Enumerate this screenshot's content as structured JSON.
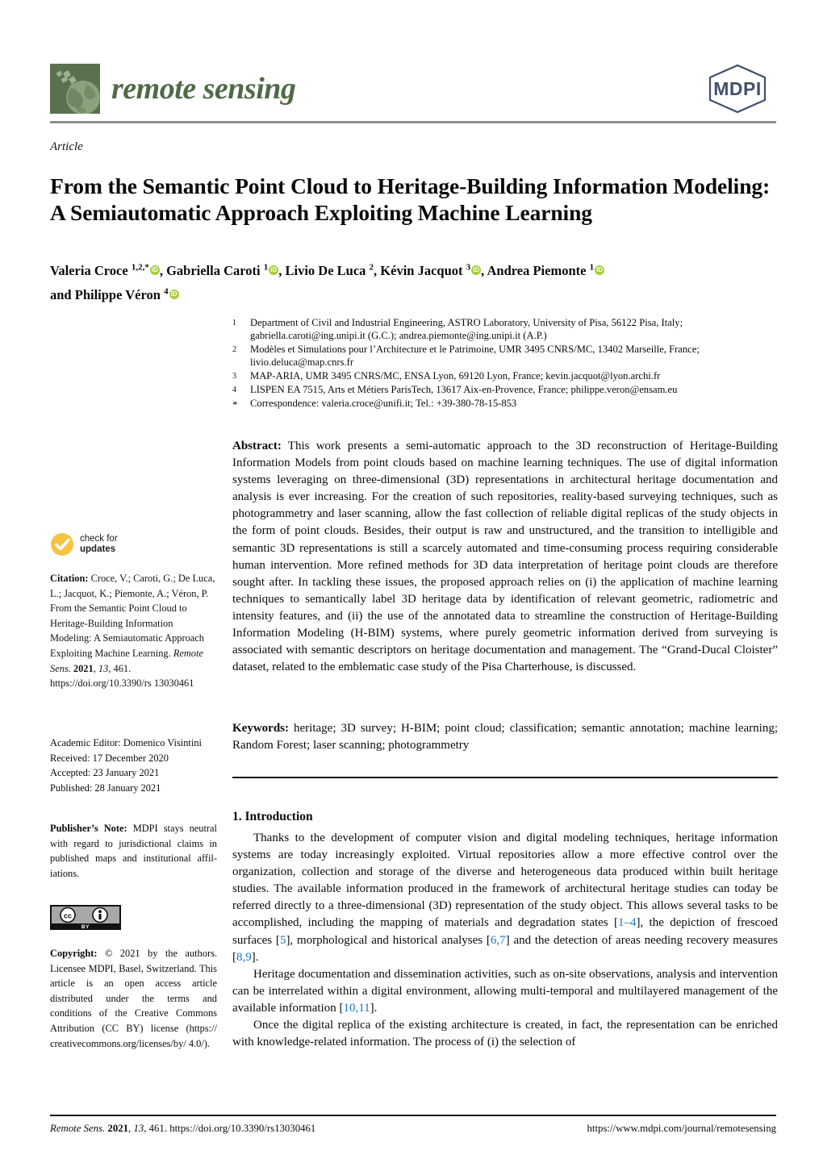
{
  "journal": {
    "name": "remote sensing",
    "logo_icon": "satellite-globe-icon",
    "logo_bg_color": "#5a7150",
    "title_color": "#4e6b46",
    "publisher_logo_text": "MDPI",
    "publisher_logo_color": "#41506b"
  },
  "article": {
    "kicker": "Article",
    "title": "From the Semantic Point Cloud to Heritage-Building Information Modeling: A Semiautomatic Approach Exploiting Machine Learning"
  },
  "authors": {
    "line1_parts": [
      {
        "name": "Valeria Croce ",
        "sup": "1,2,*",
        "orcid": true,
        "sep": ", "
      },
      {
        "name": "Gabriella Caroti ",
        "sup": "1",
        "orcid": true,
        "sep": ", "
      },
      {
        "name": "Livio De Luca ",
        "sup": "2",
        "orcid": false,
        "sep": ", "
      },
      {
        "name": "Kévin Jacquot ",
        "sup": "3",
        "orcid": true,
        "sep": ", "
      },
      {
        "name": "Andrea Piemonte ",
        "sup": "1",
        "orcid": true,
        "sep": ""
      }
    ],
    "line2_lead": "and ",
    "line2_parts": [
      {
        "name": "Philippe Véron ",
        "sup": "4",
        "orcid": true,
        "sep": ""
      }
    ],
    "orcid_label": "iD",
    "orcid_color": "#a6ce39"
  },
  "affiliations": [
    {
      "mark": "1",
      "text": "Department of Civil and Industrial Engineering, ASTRO Laboratory, University of Pisa, 56122 Pisa, Italy; gabriella.caroti@ing.unipi.it (G.C.); andrea.piemonte@ing.unipi.it (A.P.)"
    },
    {
      "mark": "2",
      "text": "Modèles et Simulations pour l’Architecture et le Patrimoine, UMR 3495 CNRS/MC, 13402 Marseille, France; livio.deluca@map.cnrs.fr"
    },
    {
      "mark": "3",
      "text": "MAP-ARIA, UMR 3495 CNRS/MC, ENSA Lyon, 69120 Lyon, France; kevin.jacquot@lyon.archi.fr"
    },
    {
      "mark": "4",
      "text": "LISPEN EA 7515, Arts et Métiers ParisTech, 13617 Aix-en-Provence, France; philippe.veron@ensam.eu"
    },
    {
      "mark": "*",
      "text": "Correspondence: valeria.croce@unifi.it; Tel.: +39-380-78-15-853"
    }
  ],
  "abstract": {
    "label": "Abstract:",
    "text": " This work presents a semi-automatic approach to the 3D reconstruction of Heritage-Building Information Models from point clouds based on machine learning techniques. The use of digital information systems leveraging on three-dimensional (3D) representations in architectural heritage documentation and analysis is ever increasing. For the creation of such repositories, reality-based surveying techniques, such as photogrammetry and laser scanning, allow the fast collection of reliable digital replicas of the study objects in the form of point clouds. Besides, their output is raw and unstructured, and the transition to intelligible and semantic 3D representations is still a scarcely automated and time-consuming process requiring considerable human intervention. More refined methods for 3D data interpretation of heritage point clouds are therefore sought after. In tackling these issues, the proposed approach relies on (i) the application of machine learning techniques to semantically label 3D heritage data by identification of relevant geometric, radiometric and intensity features, and (ii) the use of the annotated data to streamline the construction of Heritage-Building Information Modeling (H-BIM) systems, where purely geometric information derived from surveying is associated with semantic descriptors on heritage documentation and management. The “Grand-Ducal Cloister” dataset, related to the emblematic case study of the Pisa Charterhouse, is discussed."
  },
  "keywords": {
    "label": "Keywords:",
    "text": " heritage; 3D survey; H-BIM; point cloud; classification; semantic annotation; machine learning; Random Forest; laser scanning; photogrammetry"
  },
  "sidebar": {
    "check_for_updates": {
      "line1": "check for",
      "line2": "updates",
      "icon": "check-circle-icon",
      "color": "#f6c343"
    },
    "citation_label": "Citation:",
    "citation_text_1": " Croce, V.; Caroti, G.; De Luca, L.; Jacquot, K.; Piemonte, A.; Véron, P. From the Semantic Point Cloud to Heritage-Building Information Modeling: A Semiautomatic Approach Exploiting Machine Learning. ",
    "citation_journal": "Remote Sens.",
    "citation_year": " 2021",
    "citation_text_2": ", ",
    "citation_volume": "13",
    "citation_text_3": ", 461. https://doi.org/10.3390/rs 13030461",
    "academic_editor": "Academic Editor: Domenico Visintini",
    "received": "Received: 17 December 2020",
    "accepted": "Accepted: 23 January 2021",
    "published": "Published: 28 January 2021",
    "publishers_note_label": "Publisher’s Note:",
    "publishers_note_text": " MDPI stays neutral with regard to jurisdictional claims in published maps and institutional affil-iations.",
    "cc_logo": {
      "icon": "creative-commons-by-icon",
      "cc_label": "CC",
      "by_label": "BY"
    },
    "copyright_label": "Copyright:",
    "copyright_text": " © 2021 by the authors. Licensee MDPI, Basel, Switzerland. This article is an open access article distributed under the terms and conditions of the Creative Commons Attribution (CC BY) license (https:// creativecommons.org/licenses/by/ 4.0/)."
  },
  "body": {
    "section_heading": "1. Introduction",
    "paragraphs": [
      {
        "segments": [
          {
            "t": "Thanks to the development of computer vision and digital modeling techniques, heritage information systems are today increasingly exploited. Virtual repositories allow a more effective control over the organization, collection and storage of the diverse and heterogeneous data produced within built heritage studies. The available information produced in the framework of architectural heritage studies can today be referred directly to a three-dimensional (3D) representation of the study object. This allows several tasks to be accomplished, including the mapping of materials and degradation states ["
          },
          {
            "t": "1–4",
            "ref": true
          },
          {
            "t": "], the depiction of frescoed surfaces ["
          },
          {
            "t": "5",
            "ref": true
          },
          {
            "t": "], morphological and historical analyses ["
          },
          {
            "t": "6,7",
            "ref": true
          },
          {
            "t": "] and the detection of areas needing recovery measures ["
          },
          {
            "t": "8,9",
            "ref": true
          },
          {
            "t": "]."
          }
        ]
      },
      {
        "segments": [
          {
            "t": "Heritage documentation and dissemination activities, such as on-site observations, analysis and intervention can be interrelated within a digital environment, allowing multi-temporal and multilayered management of the available information ["
          },
          {
            "t": "10,11",
            "ref": true
          },
          {
            "t": "]."
          }
        ]
      },
      {
        "segments": [
          {
            "t": "Once the digital replica of the existing architecture is created, in fact, the representation can be enriched with knowledge-related information. The process of (i) the selection of"
          }
        ]
      }
    ],
    "ref_color": "#1c6fd0"
  },
  "footer": {
    "left_journal": "Remote Sens.",
    "left_year": " 2021",
    "left_mid": ", ",
    "left_volume": "13",
    "left_rest": ", 461. https://doi.org/10.3390/rs13030461",
    "right": "https://www.mdpi.com/journal/remotesensing"
  }
}
